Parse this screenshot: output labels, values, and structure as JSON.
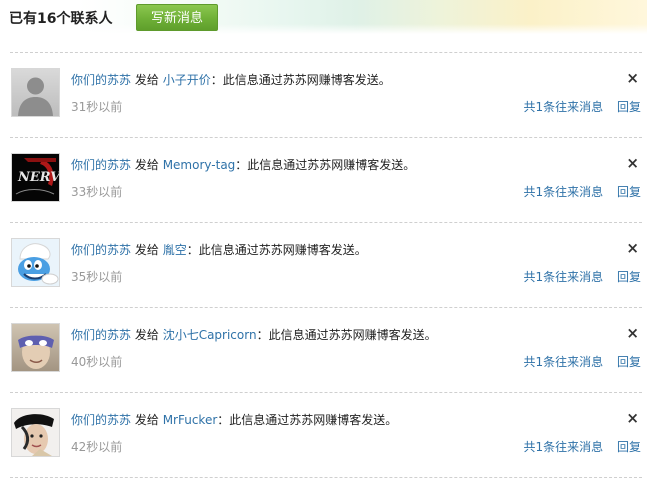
{
  "header": {
    "title": "已有16个联系人",
    "compose_label": "写新消息"
  },
  "messages": [
    {
      "sender": "你们的苏苏",
      "verb": "发给",
      "recipient": "小子开价",
      "content": "：此信息通过苏苏网赚博客发送。",
      "time": "31秒以前",
      "thread_label": "共1条往来消息",
      "reply_label": "回复",
      "close_label": "×",
      "avatar": "default-gray-silhouette"
    },
    {
      "sender": "你们的苏苏",
      "verb": "发给",
      "recipient": "Memory-tag",
      "content": "：此信息通过苏苏网赚博客发送。",
      "time": "33秒以前",
      "thread_label": "共1条往来消息",
      "reply_label": "回复",
      "close_label": "×",
      "avatar": "nerv-logo",
      "avatar_text": "NERV"
    },
    {
      "sender": "你们的苏苏",
      "verb": "发给",
      "recipient": "胤空",
      "content": "：此信息通过苏苏网赚博客发送。",
      "time": "35秒以前",
      "thread_label": "共1条往来消息",
      "reply_label": "回复",
      "close_label": "×",
      "avatar": "blue-cartoon-character"
    },
    {
      "sender": "你们的苏苏",
      "verb": "发给",
      "recipient": "沈小七Capricorn",
      "content": "：此信息通过苏苏网赚博客发送。",
      "time": "40秒以前",
      "thread_label": "共1条往来消息",
      "reply_label": "回复",
      "close_label": "×",
      "avatar": "person-with-mask"
    },
    {
      "sender": "你们的苏苏",
      "verb": "发给",
      "recipient": "MrFucker",
      "content": "：此信息通过苏苏网赚博客发送。",
      "time": "42秒以前",
      "thread_label": "共1条往来消息",
      "reply_label": "回复",
      "close_label": "×",
      "avatar": "person-with-black-hat"
    }
  ]
}
